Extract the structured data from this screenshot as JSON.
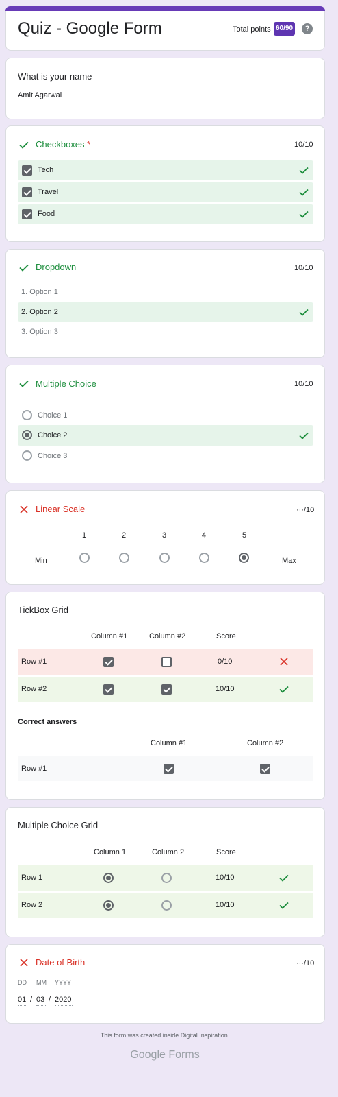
{
  "header": {
    "title": "Quiz - Google Form",
    "total_label": "Total points",
    "total_value": "60/90",
    "help_icon": "?"
  },
  "name_q": {
    "title": "What is your name",
    "answer": "Amit Agarwal"
  },
  "checkboxes": {
    "title": "Checkboxes",
    "required": "*",
    "points": "10/10",
    "options": [
      "Tech",
      "Travel",
      "Food"
    ]
  },
  "dropdown": {
    "title": "Dropdown",
    "points": "10/10",
    "options": [
      "1. Option 1",
      "2. Option 2",
      "3. Option 3"
    ]
  },
  "multiple_choice": {
    "title": "Multiple Choice",
    "points": "10/10",
    "options": [
      "Choice 1",
      "Choice 2",
      "Choice 3"
    ]
  },
  "linear_scale": {
    "title": "Linear Scale",
    "points": "···/10",
    "min_label": "Min",
    "max_label": "Max",
    "values": [
      "1",
      "2",
      "3",
      "4",
      "5"
    ],
    "selected": "5"
  },
  "tickbox_grid": {
    "title": "TickBox Grid",
    "columns": [
      "Column #1",
      "Column #2"
    ],
    "score_header": "Score",
    "rows": [
      {
        "label": "Row #1",
        "score": "0/10"
      },
      {
        "label": "Row #2",
        "score": "10/10"
      }
    ],
    "correct_label": "Correct answers",
    "correct_columns": [
      "Column #1",
      "Column #2"
    ],
    "correct_row": "Row #1"
  },
  "mc_grid": {
    "title": "Multiple Choice Grid",
    "columns": [
      "Column 1",
      "Column 2"
    ],
    "score_header": "Score",
    "rows": [
      {
        "label": "Row 1",
        "score": "10/10"
      },
      {
        "label": "Row 2",
        "score": "10/10"
      }
    ]
  },
  "dob": {
    "title": "Date of Birth",
    "points": "···/10",
    "labels": [
      "DD",
      "MM",
      "YYYY"
    ],
    "values": [
      "01",
      "03",
      "2020"
    ],
    "sep": "/"
  },
  "footer": {
    "note": "This form was created inside Digital Inspiration.",
    "brand_google": "Google",
    "brand_forms": "Forms"
  },
  "colors": {
    "accent": "#673ab7",
    "correct": "#1e8e3e",
    "wrong": "#d93025"
  }
}
